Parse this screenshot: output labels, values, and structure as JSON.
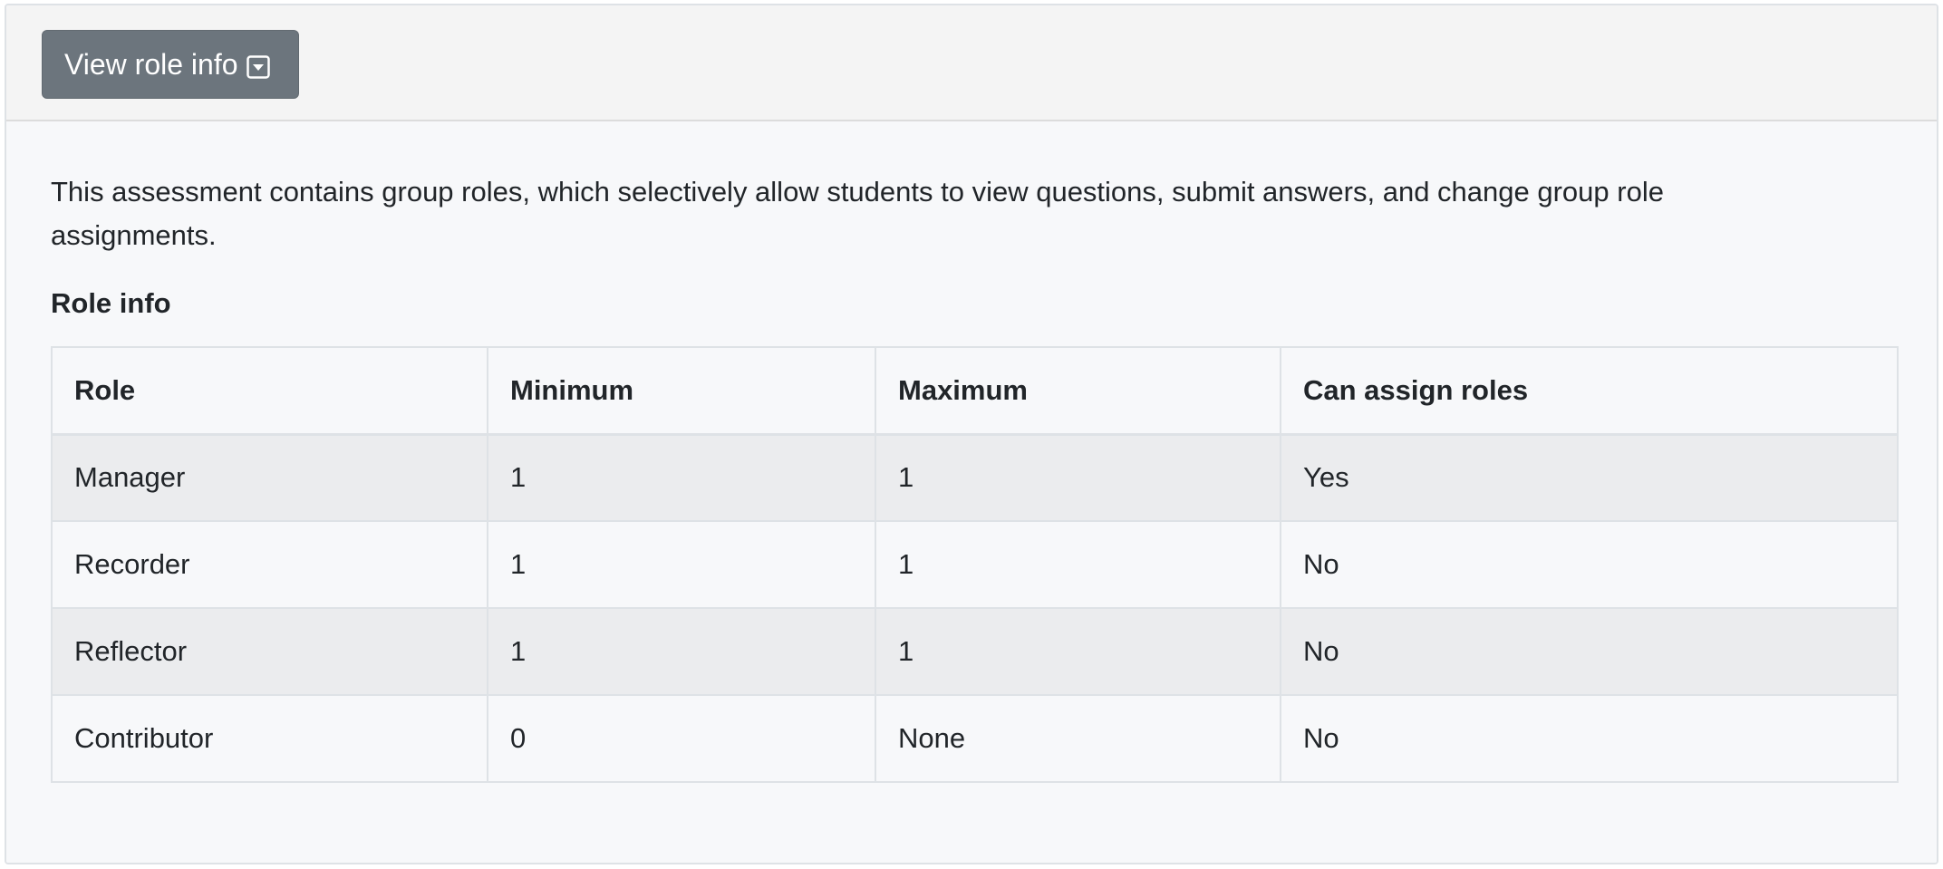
{
  "toolbar": {
    "toggle_label": "View role info",
    "toggle_icon": "caret-square-down-icon"
  },
  "body": {
    "intro": "This assessment contains group roles, which selectively allow students to view questions, submit answers, and change group role assignments.",
    "section_title": "Role info"
  },
  "table": {
    "columns": [
      "Role",
      "Minimum",
      "Maximum",
      "Can assign roles"
    ],
    "rows": [
      [
        "Manager",
        "1",
        "1",
        "Yes"
      ],
      [
        "Recorder",
        "1",
        "1",
        "No"
      ],
      [
        "Reflector",
        "1",
        "1",
        "No"
      ],
      [
        "Contributor",
        "0",
        "None",
        "No"
      ]
    ]
  },
  "colors": {
    "button_bg": "#6c757d",
    "header_bg": "#f4f4f4",
    "stripe_bg": "#ebecee",
    "border": "#dee2e6"
  }
}
